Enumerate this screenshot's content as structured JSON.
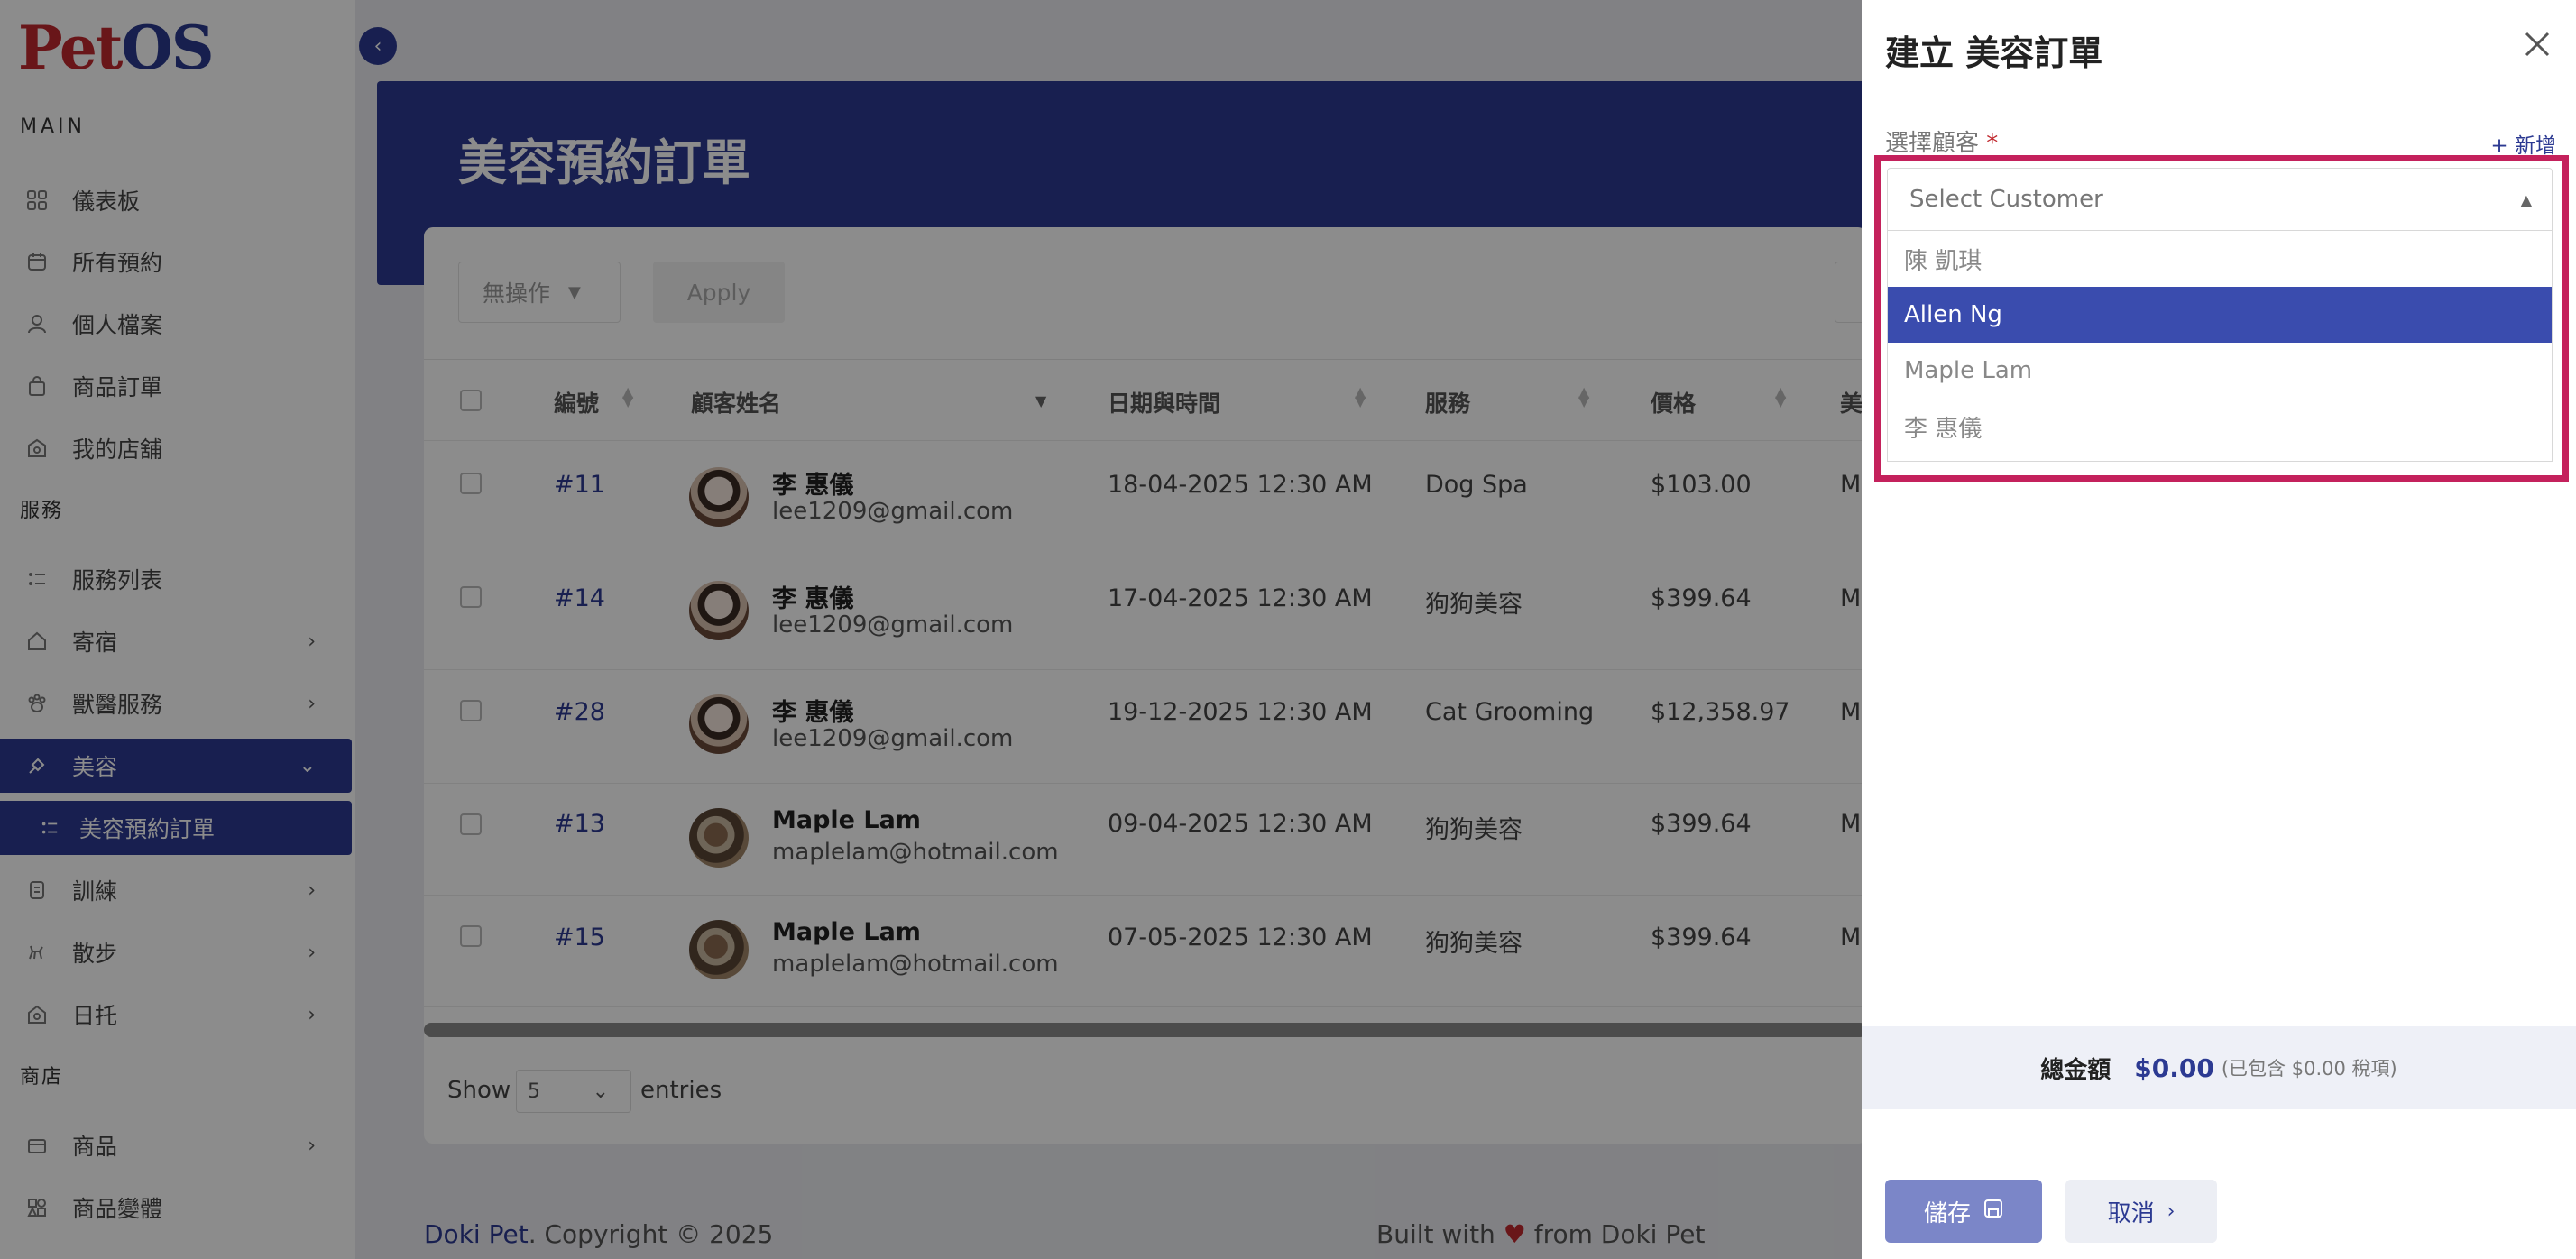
{
  "brand": {
    "logo_p": "Pet",
    "logo_os": "OS"
  },
  "sidebar": {
    "section_main": "MAIN",
    "section_services": "服務",
    "section_shop": "商店",
    "main_items": [
      {
        "label": "儀表板",
        "icon": "dashboard-icon"
      },
      {
        "label": "所有預約",
        "icon": "calendar-icon"
      },
      {
        "label": "個人檔案",
        "icon": "user-icon"
      },
      {
        "label": "商品訂單",
        "icon": "bag-icon"
      },
      {
        "label": "我的店舖",
        "icon": "store-icon"
      }
    ],
    "service_items": [
      {
        "label": "服務列表",
        "icon": "list-icon"
      },
      {
        "label": "寄宿",
        "icon": "home-icon"
      },
      {
        "label": "獸醫服務",
        "icon": "vet-icon"
      },
      {
        "label": "美容",
        "icon": "brush-icon"
      },
      {
        "label": "美容預約訂單",
        "icon": "list-icon"
      },
      {
        "label": "訓練",
        "icon": "training-icon"
      },
      {
        "label": "散步",
        "icon": "walk-icon"
      },
      {
        "label": "日托",
        "icon": "daycare-icon"
      }
    ],
    "shop_items": [
      {
        "label": "商品",
        "icon": "product-icon"
      },
      {
        "label": "商品變體",
        "icon": "variant-icon"
      }
    ]
  },
  "page": {
    "title": "美容預約訂單"
  },
  "toolbar": {
    "bulk_action": "無操作",
    "apply": "Apply"
  },
  "table": {
    "headers": [
      "編號",
      "顧客姓名",
      "日期與時間",
      "服務",
      "價格",
      "美"
    ],
    "rows": [
      {
        "id": "#11",
        "name": "李 惠儀",
        "email": "lee1209@gmail.com",
        "datetime": "18-04-2025 12:30 AM",
        "service": "Dog Spa",
        "price": "$103.00",
        "extra": "M"
      },
      {
        "id": "#14",
        "name": "李 惠儀",
        "email": "lee1209@gmail.com",
        "datetime": "17-04-2025 12:30 AM",
        "service": "狗狗美容",
        "price": "$399.64",
        "extra": "M"
      },
      {
        "id": "#28",
        "name": "李 惠儀",
        "email": "lee1209@gmail.com",
        "datetime": "19-12-2025 12:30 AM",
        "service": "Cat Grooming",
        "price": "$12,358.97",
        "extra": "M"
      },
      {
        "id": "#13",
        "name": "Maple Lam",
        "email": "maplelam@hotmail.com",
        "datetime": "09-04-2025 12:30 AM",
        "service": "狗狗美容",
        "price": "$399.64",
        "extra": "M"
      },
      {
        "id": "#15",
        "name": "Maple Lam",
        "email": "maplelam@hotmail.com",
        "datetime": "07-05-2025 12:30 AM",
        "service": "狗狗美容",
        "price": "$399.64",
        "extra": "M"
      }
    ]
  },
  "pagination": {
    "show": "Show",
    "page_size": "5",
    "entries": "entries"
  },
  "footer": {
    "brand": "Doki Pet",
    "copyright": ". Copyright © 2025",
    "built_with": "Built with",
    "heart": "♥",
    "from": "from Doki Pet"
  },
  "drawer": {
    "title": "建立 美容訂單",
    "customer_label": "選擇顧客",
    "required_mark": "*",
    "add_new": "+ 新增",
    "select_placeholder": "Select Customer",
    "options": [
      "陳 凱琪",
      "Allen Ng",
      "Maple Lam",
      "李 惠儀"
    ],
    "selected_option": "Allen Ng",
    "total_label": "總金額",
    "total_value": "$0.00",
    "total_tax": "(已包含 $0.00 稅項)",
    "save": "儲存",
    "cancel": "取消"
  },
  "colors": {
    "primary": "#2c3a92",
    "accent_red": "#c0282e",
    "highlight": "#c4215c"
  }
}
